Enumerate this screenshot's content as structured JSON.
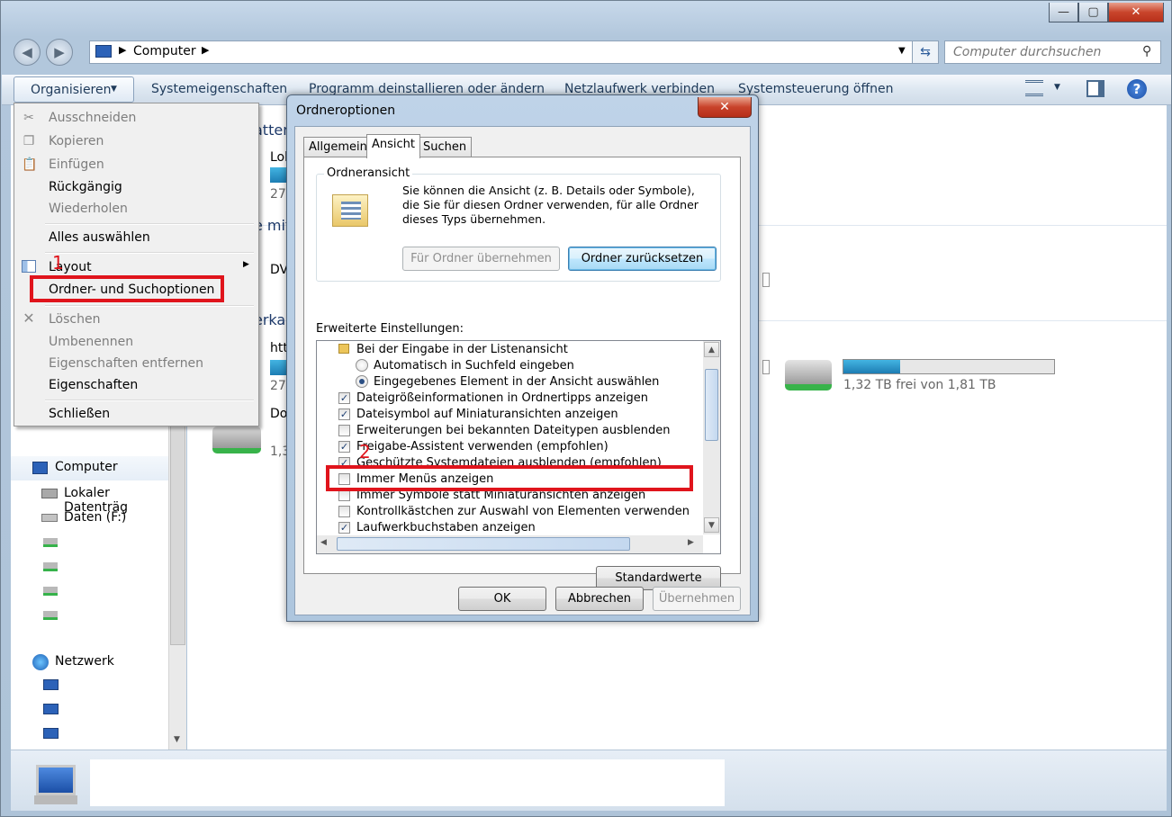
{
  "explorer": {
    "breadcrumb": "Computer",
    "search_placeholder": "Computer durchsuchen",
    "toolbar": {
      "organize": "Organisieren",
      "system_properties": "Systemeigenschaften",
      "uninstall": "Programm deinstallieren oder ändern",
      "map_drive": "Netzlaufwerk verbinden",
      "control_panel": "Systemsteuerung öffnen"
    },
    "nav": {
      "computer": "Computer",
      "local_disk": "Lokaler Datenträg",
      "data_drive": "Daten (F:)",
      "network": "Netzwerk"
    },
    "content": {
      "fragments": [
        "atten",
        "Lok",
        "27,",
        "e mit",
        "DV",
        "erka",
        "htt",
        "27,",
        "Do",
        "1,3"
      ],
      "drive_free": "1,32 TB frei von 1,81 TB",
      "drive_fill": 0.27
    }
  },
  "menu": {
    "items": {
      "cut": "Ausschneiden",
      "copy": "Kopieren",
      "paste": "Einfügen",
      "undo": "Rückgängig",
      "redo": "Wiederholen",
      "select_all": "Alles auswählen",
      "layout": "Layout",
      "folder_options": "Ordner- und Suchoptionen",
      "delete": "Löschen",
      "rename": "Umbenennen",
      "remove_props": "Eigenschaften entfernen",
      "properties": "Eigenschaften",
      "close": "Schließen"
    }
  },
  "annotations": {
    "step1": "1",
    "step2": "2"
  },
  "dialog": {
    "title": "Ordneroptionen",
    "tabs": [
      "Allgemein",
      "Ansicht",
      "Suchen"
    ],
    "active_tab": "Ansicht",
    "group_title": "Ordneransicht",
    "group_text": "Sie können die Ansicht (z. B. Details oder Symbole), die Sie für diesen Ordner verwenden, für alle Ordner dieses Typs übernehmen.",
    "apply_folders": "Für Ordner übernehmen",
    "reset_folders": "Ordner zurücksetzen",
    "advanced_label": "Erweiterte Einstellungen:",
    "tree": [
      {
        "label": "Bei der Eingabe in der Listenansicht",
        "kind": "folder",
        "checked": false
      },
      {
        "label": "Automatisch in Suchfeld eingeben",
        "kind": "radio",
        "checked": false
      },
      {
        "label": "Eingegebenes Element in der Ansicht auswählen",
        "kind": "radio",
        "checked": true
      },
      {
        "label": "Dateigrößeinformationen in Ordnertipps anzeigen",
        "kind": "checkbox",
        "checked": true
      },
      {
        "label": "Dateisymbol auf Miniaturansichten anzeigen",
        "kind": "checkbox",
        "checked": true
      },
      {
        "label": "Erweiterungen bei bekannten Dateitypen ausblenden",
        "kind": "checkbox",
        "checked": false
      },
      {
        "label": "Freigabe-Assistent verwenden (empfohlen)",
        "kind": "checkbox",
        "checked": true
      },
      {
        "label": "Geschützte Systemdateien ausblenden (empfohlen)",
        "kind": "checkbox",
        "checked": true
      },
      {
        "label": "Immer Menüs anzeigen",
        "kind": "checkbox",
        "checked": false
      },
      {
        "label": "Immer Symbole statt Miniaturansichten anzeigen",
        "kind": "checkbox",
        "checked": false
      },
      {
        "label": "Kontrollkästchen zur Auswahl von Elementen verwenden",
        "kind": "checkbox",
        "checked": false
      },
      {
        "label": "Laufwerkbuchstaben anzeigen",
        "kind": "checkbox",
        "checked": true
      }
    ],
    "defaults": "Standardwerte",
    "ok": "OK",
    "cancel": "Abbrechen",
    "apply": "Übernehmen"
  }
}
